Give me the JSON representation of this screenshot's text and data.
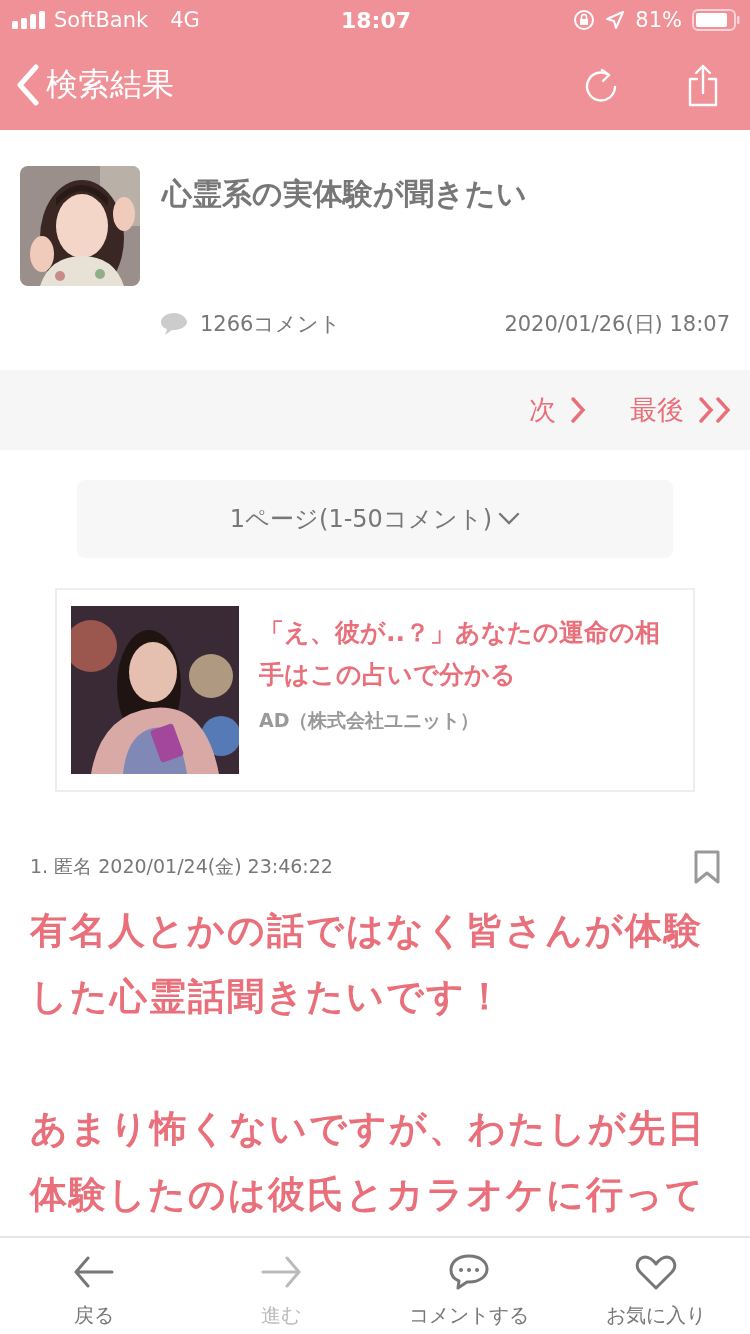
{
  "status_bar": {
    "carrier": "SoftBank",
    "network": "4G",
    "time": "18:07",
    "battery": "81%"
  },
  "nav": {
    "back_label": "検索結果"
  },
  "topic": {
    "title": "心霊系の実体験が聞きたい",
    "comment_count": "1266コメント",
    "date": "2020/01/26(日) 18:07"
  },
  "pager": {
    "next": "次",
    "last": "最後"
  },
  "page_select": {
    "label": "1ページ(1-50コメント)"
  },
  "ad": {
    "headline": "「え、彼が..？」あなたの運命の相手はこの占いで分かる",
    "sponsor": "AD（株式会社ユニット）"
  },
  "post": {
    "meta": "1. 匿名 2020/01/24(金) 23:46:22",
    "bookmarked": false,
    "paragraphs": [
      "有名人とかの話ではなく皆さんが体験した心霊話聞きたいです！",
      "あまり怖くないですが、わたしが先日体験したのは彼氏とカラオケに行って"
    ]
  },
  "toolbar": [
    {
      "kind": "back",
      "label": "戻る",
      "disabled": false
    },
    {
      "kind": "forward",
      "label": "進む",
      "disabled": true
    },
    {
      "kind": "comment",
      "label": "コメントする",
      "disabled": false
    },
    {
      "kind": "favorite",
      "label": "お気に入り",
      "disabled": false
    }
  ]
}
